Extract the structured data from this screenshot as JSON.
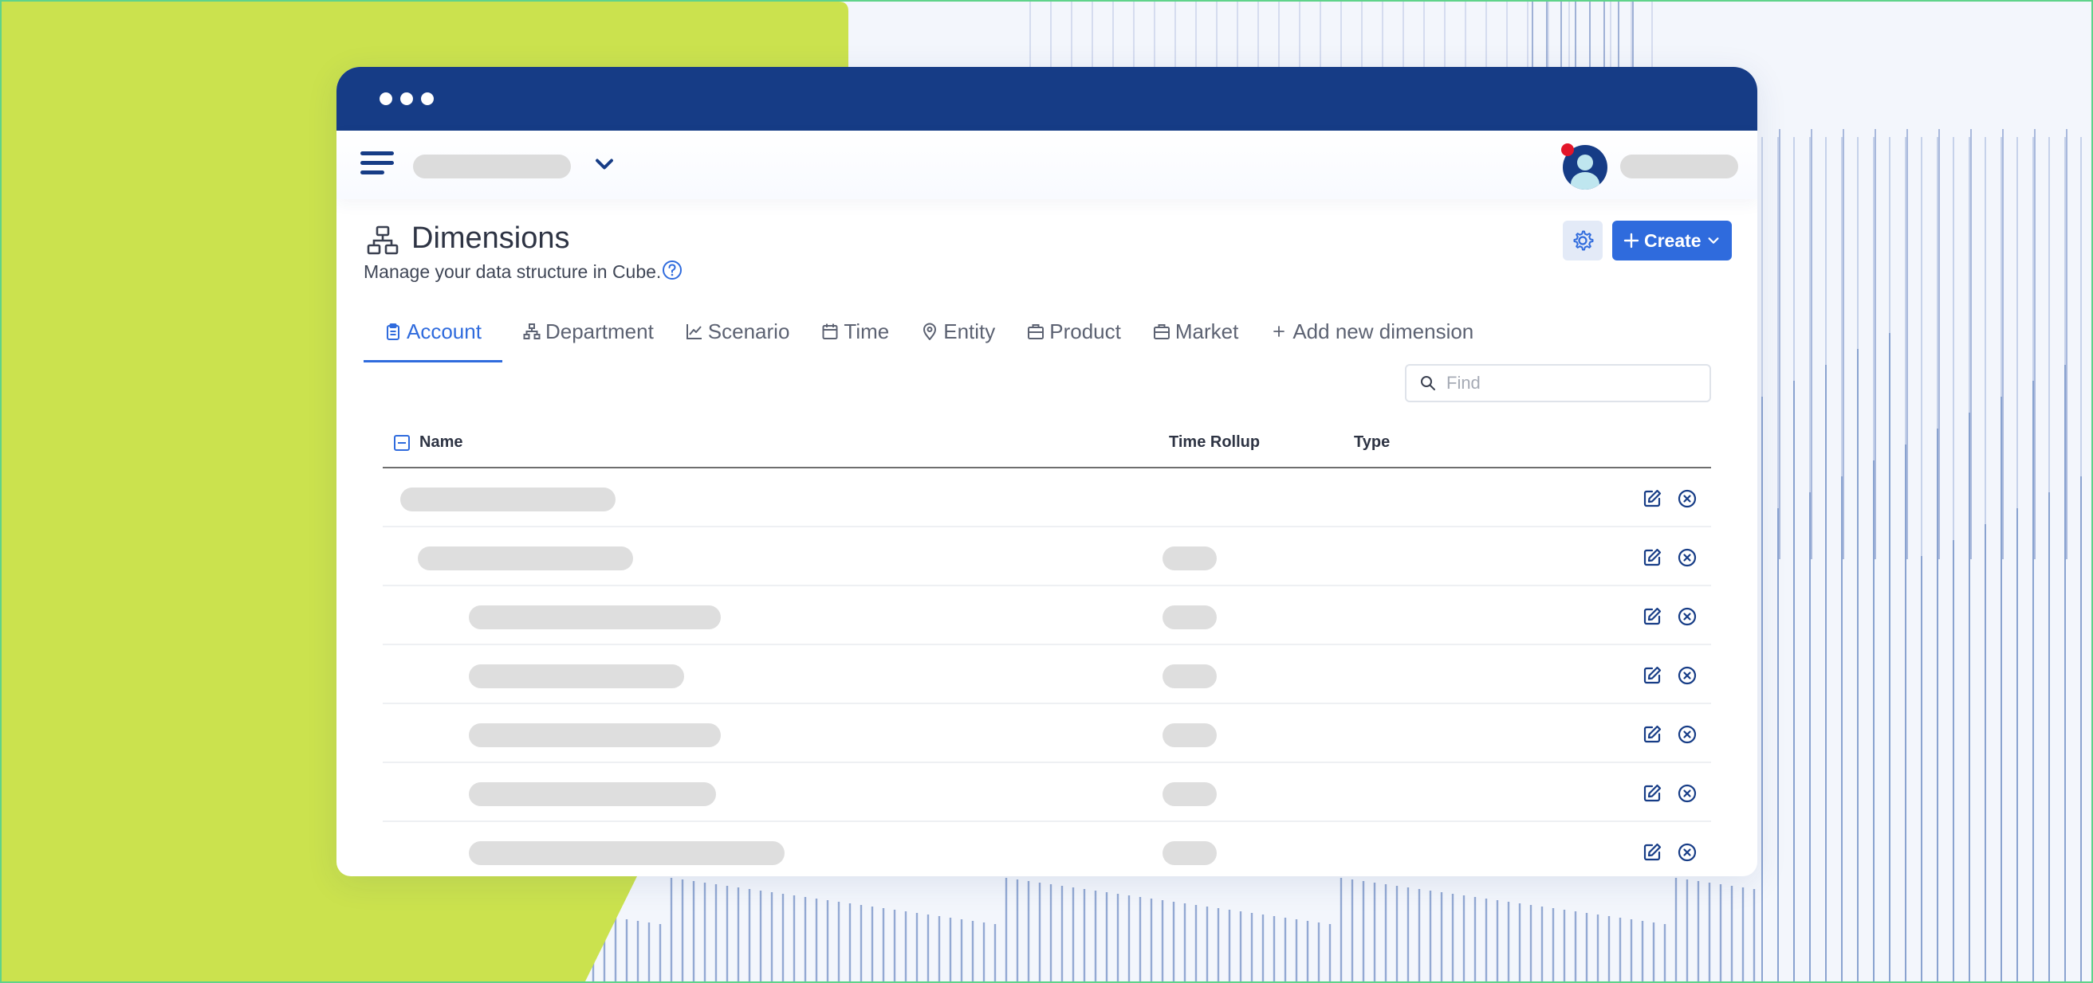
{
  "colors": {
    "brand_navy": "#163c86",
    "accent_blue": "#2f6bdd",
    "lime": "#cbe24e",
    "skeleton": "#dedede"
  },
  "header": {
    "menu_icon": "hamburger-icon",
    "workspace_dropdown_icon": "chevron-down-icon",
    "avatar_icon": "user-avatar-icon",
    "notification_icon": "notification-dot-icon"
  },
  "page": {
    "icon": "hierarchy-icon",
    "title": "Dimensions",
    "subtitle": "Manage your data structure in Cube.",
    "help_icon": "help-circle-icon"
  },
  "actions": {
    "settings_icon": "gear-icon",
    "create_label": "Create"
  },
  "tabs": [
    {
      "label": "Account",
      "icon": "clipboard-icon",
      "active": true
    },
    {
      "label": "Department",
      "icon": "org-chart-icon",
      "active": false
    },
    {
      "label": "Scenario",
      "icon": "line-chart-icon",
      "active": false
    },
    {
      "label": "Time",
      "icon": "calendar-icon",
      "active": false
    },
    {
      "label": "Entity",
      "icon": "map-pin-icon",
      "active": false
    },
    {
      "label": "Product",
      "icon": "briefcase-icon",
      "active": false
    },
    {
      "label": "Market",
      "icon": "briefcase-icon",
      "active": false
    },
    {
      "label": "Add new dimension",
      "icon": "plus-icon",
      "active": false
    }
  ],
  "search": {
    "placeholder": "Find"
  },
  "table": {
    "columns": [
      "Name",
      "Time Rollup",
      "Type"
    ],
    "row_actions": [
      "edit-icon",
      "delete-icon"
    ],
    "row_count": 7
  }
}
